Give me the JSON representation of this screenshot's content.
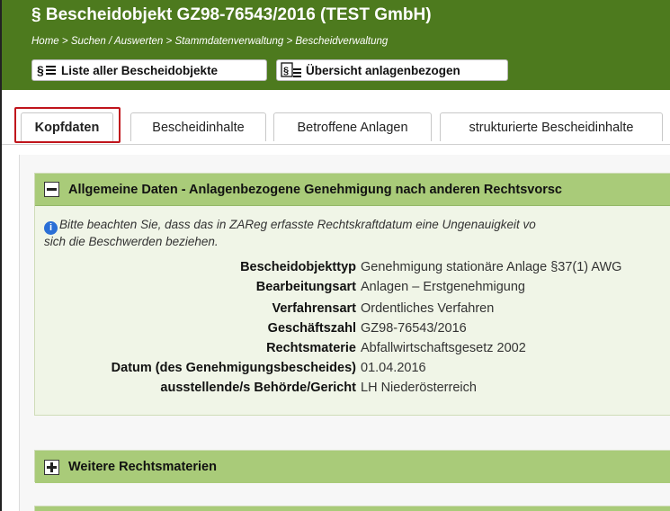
{
  "header": {
    "title": "§  Bescheidobjekt GZ98-76543/2016 (TEST GmbH)",
    "breadcrumb": [
      "Home",
      "Suchen / Auswerten",
      "Stammdatenverwaltung",
      "Bescheidverwaltung"
    ],
    "breadcrumb_sep": ">",
    "buttons": {
      "list_label": "Liste aller Bescheidobjekte",
      "overview_label": "Übersicht anlagenbezogen"
    }
  },
  "tabs": [
    {
      "label": "Kopfdaten",
      "active": true
    },
    {
      "label": "Bescheidinhalte",
      "active": false
    },
    {
      "label": "Betroffene Anlagen",
      "active": false
    },
    {
      "label": "strukturierte Bescheidinhalte",
      "active": false
    }
  ],
  "panels": {
    "general": {
      "title": "Allgemeine Daten - Anlagenbezogene Genehmigung nach anderen Rechtsvorsc",
      "note_line1": "Bitte beachten Sie, dass das in ZAReg erfasste Rechtskraftdatum eine Ungenauigkeit vo",
      "note_line2": "sich die Beschwerden beziehen.",
      "fields": [
        {
          "label": "Bescheidobjekttyp",
          "value": "Genehmigung stationäre Anlage §37(1) AWG"
        },
        {
          "label": "Bearbeitungsart",
          "value": "Anlagen – Erstgenehmigung"
        },
        {
          "label": "Verfahrensart",
          "value": "Ordentliches Verfahren"
        },
        {
          "label": "Geschäftszahl",
          "value": "GZ98-76543/2016"
        },
        {
          "label": "Rechtsmaterie",
          "value": "Abfallwirtschaftsgesetz 2002"
        },
        {
          "label": "Datum (des Genehmigungsbescheides)",
          "value": "01.04.2016"
        },
        {
          "label": "ausstellende/s Behörde/Gericht",
          "value": "LH Niederösterreich"
        }
      ]
    },
    "further": {
      "title": "Weitere Rechtsmaterien"
    }
  },
  "colors": {
    "header_bg": "#4d7a1e",
    "panel_head_bg": "#a9cb79",
    "panel_body_bg": "#f0f5e7",
    "active_tab_outline": "#c0141c",
    "info_icon": "#2a6fd6"
  }
}
